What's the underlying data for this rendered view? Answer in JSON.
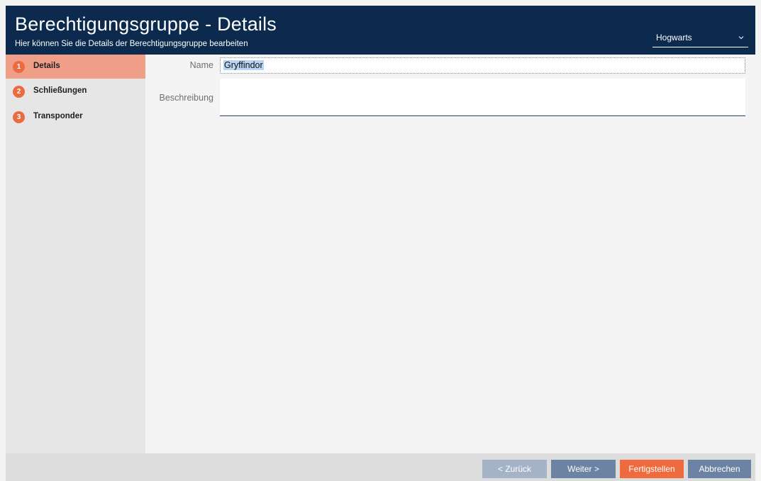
{
  "header": {
    "title": "Berechtigungsgruppe - Details",
    "subtitle": "Hier können Sie die Details der Berechtigungsgruppe bearbeiten",
    "project_select": {
      "value": "Hogwarts"
    }
  },
  "steps": [
    {
      "number": "1",
      "label": "Details",
      "active": true
    },
    {
      "number": "2",
      "label": "Schließungen",
      "active": false
    },
    {
      "number": "3",
      "label": "Transponder",
      "active": false
    }
  ],
  "form": {
    "name_label": "Name",
    "name_value": "Gryffindor",
    "description_label": "Beschreibung",
    "description_value": ""
  },
  "footer": {
    "back_label": "< Zurück",
    "next_label": "Weiter >",
    "finish_label": "Fertigstellen",
    "cancel_label": "Abbrechen"
  },
  "colors": {
    "header_bg": "#0b2a4e",
    "accent_orange": "#ef6b3e",
    "active_step_bg": "#ef9e87",
    "button_blue": "#6c83a3"
  },
  "icons": {
    "project_dropdown": "chevron-down-icon"
  }
}
